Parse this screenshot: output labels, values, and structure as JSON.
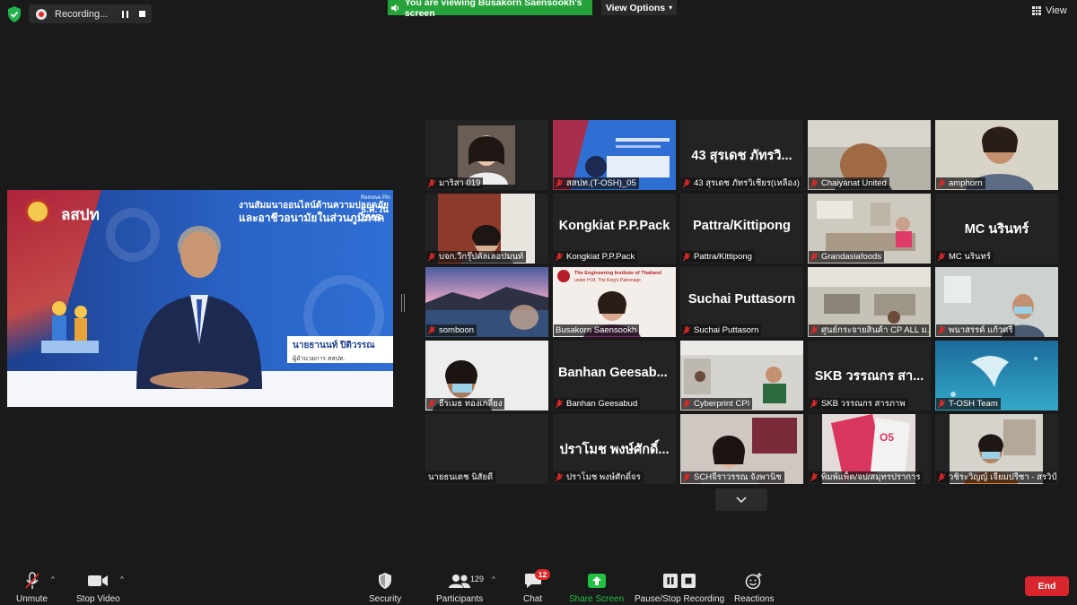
{
  "recording": {
    "label": "Recording..."
  },
  "banner": {
    "text": "You are viewing Busakorn Saensookh's screen",
    "view_options": "View Options"
  },
  "view_label": "View",
  "shared_screen": {
    "logo": "ลสปท",
    "title_line1": "งานสัมมนาออนไลน์ด้านความปลอดภัย",
    "title_line2": "และอาชีวอนามัยในส่วนภูมิภาค",
    "date_label": "Remove Pin",
    "date_day": "ธ.ค.วัน",
    "date_year": "2565",
    "presenter_name": "นายธานนท์ ปิติวรรณ",
    "presenter_role": "ผู้อำนวยการ สสปท."
  },
  "tiles": [
    {
      "name": "มาริสา 019",
      "kind": "video",
      "muted": true
    },
    {
      "name": "สสปท.(T-OSH)_05",
      "kind": "video",
      "muted": true
    },
    {
      "name": "43 สุรเดช ภัทรวิเชียร(เหลือง)",
      "kind": "name",
      "big": "43 สุรเดช ภัทรวิ...",
      "muted": true
    },
    {
      "name": "Chaiyanat United",
      "kind": "video",
      "muted": true
    },
    {
      "name": "amphorn",
      "kind": "video",
      "muted": true
    },
    {
      "name": "บจก.วีกรุ๊ปคัลเลอปมนท์",
      "kind": "video",
      "muted": true
    },
    {
      "name": "Kongkiat P.P.Pack",
      "kind": "name",
      "big": "Kongkiat P.P.Pack",
      "muted": true
    },
    {
      "name": "Pattra/Kittipong",
      "kind": "name",
      "big": "Pattra/Kittipong",
      "muted": true
    },
    {
      "name": "Grandasiafoods",
      "kind": "video",
      "muted": true
    },
    {
      "name": "MC นรินทร์",
      "kind": "name",
      "big": "MC นรินทร์",
      "muted": true
    },
    {
      "name": "somboon",
      "kind": "video",
      "muted": true
    },
    {
      "name": "Busakorn Saensookh",
      "kind": "video",
      "muted": false,
      "active": true
    },
    {
      "name": "Suchai Puttasorn",
      "kind": "name",
      "big": "Suchai Puttasorn",
      "muted": true
    },
    {
      "name": "ศูนย์กระจายสินค้า CP ALL ม...",
      "kind": "video",
      "muted": true
    },
    {
      "name": "พนาสรรค์ แก้วศรี",
      "kind": "video",
      "muted": true
    },
    {
      "name": "ธีรเมธ ทองเกลี้ยง",
      "kind": "video",
      "muted": true
    },
    {
      "name": "Banhan  Geesabud",
      "kind": "name",
      "big": "Banhan   Geesab...",
      "muted": true
    },
    {
      "name": "Cyberprint CPI",
      "kind": "video",
      "muted": true
    },
    {
      "name": "SKB วรรณกร สารภาพ",
      "kind": "name",
      "big": "SKB วรรณกร สา...",
      "muted": true
    },
    {
      "name": "T-OSH Team",
      "kind": "video",
      "muted": true
    },
    {
      "name": "นายธนเดช นิสัยดี",
      "kind": "video",
      "muted": false
    },
    {
      "name": "ปราโมช พงษ์ศักดิ์จร",
      "kind": "name",
      "big": "ปราโมช พงษ์ศักดิ์...",
      "muted": true
    },
    {
      "name": "SCHจีราวรรณ จังพานิช",
      "kind": "video",
      "muted": true
    },
    {
      "name": "พิมพ์แพ็ค/จป/สมุทรปราการ",
      "kind": "video",
      "muted": true
    },
    {
      "name": "วชิระวิญญ์ เจียมปรีชา - สรวิป์...",
      "kind": "video",
      "muted": true
    }
  ],
  "busakorn_slide": {
    "line1": "The Engineering Institute of Thailand",
    "line2": "under H.M. The King's Patronage"
  },
  "toolbar": {
    "unmute": "Unmute",
    "stop_video": "Stop Video",
    "security": "Security",
    "participants": "Participants",
    "participants_count": "129",
    "chat": "Chat",
    "chat_badge": "12",
    "share_screen": "Share Screen",
    "pause_stop": "Pause/Stop Recording",
    "reactions": "Reactions",
    "end": "End"
  },
  "colors": {
    "banner_green": "#26a23a",
    "share_green": "#22c043",
    "end_red": "#d9262e",
    "active_border": "#cbd800",
    "muted_red": "#e02828"
  }
}
